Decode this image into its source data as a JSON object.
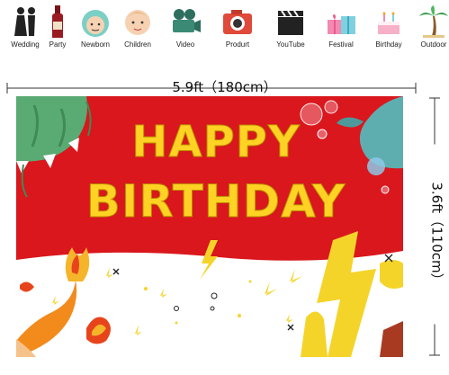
{
  "icons": [
    {
      "name": "wedding-couple-icon",
      "label": "Wedding"
    },
    {
      "name": "wine-bottle-icon",
      "label": "Party"
    },
    {
      "name": "baby-face-icon",
      "label": "Newborn"
    },
    {
      "name": "child-face-icon",
      "label": "Children"
    },
    {
      "name": "film-camera-icon",
      "label": "Video"
    },
    {
      "name": "photo-camera-icon",
      "label": "Produrt"
    },
    {
      "name": "clapperboard-icon",
      "label": "YouTube"
    },
    {
      "name": "gift-box-icon",
      "label": "Festival"
    },
    {
      "name": "birthday-cake-icon",
      "label": "Birthday"
    },
    {
      "name": "palm-tree-icon",
      "label": "Outdoor"
    }
  ],
  "dimensions": {
    "width_label": "5.9ft（180cm）",
    "height_label": "3.6ft（110cm）"
  },
  "banner": {
    "line1": "HAPPY",
    "line2": "BIRTHDAY"
  },
  "colors": {
    "banner_red": "#d9171d",
    "text_yellow": "#ffd223",
    "bolt_yellow": "#f5d42a",
    "flame_orange": "#f28a1c"
  }
}
